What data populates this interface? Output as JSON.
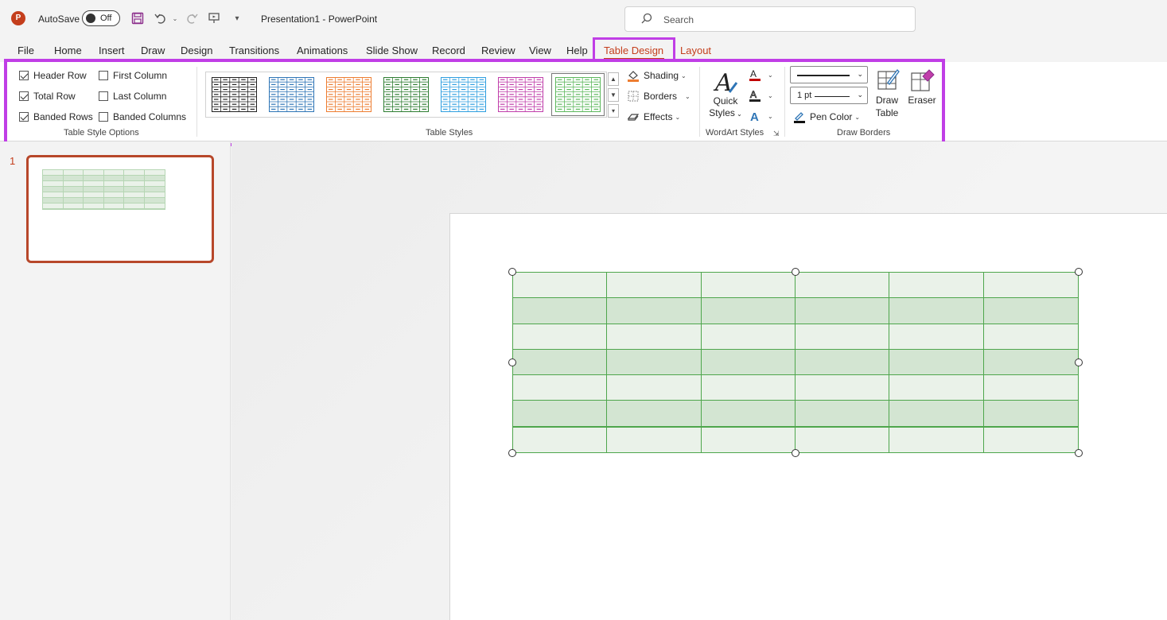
{
  "titlebar": {
    "app_icon_letter": "P",
    "autosave_label": "AutoSave",
    "autosave_state": "Off",
    "document_title": "Presentation1  -  PowerPoint",
    "search_placeholder": "Search",
    "icons": [
      "save-icon",
      "undo-icon",
      "redo-icon",
      "present-icon",
      "customize-qat-icon"
    ]
  },
  "tabs": [
    {
      "label": "File"
    },
    {
      "label": "Home"
    },
    {
      "label": "Insert"
    },
    {
      "label": "Draw"
    },
    {
      "label": "Design"
    },
    {
      "label": "Transitions"
    },
    {
      "label": "Animations"
    },
    {
      "label": "Slide Show"
    },
    {
      "label": "Record"
    },
    {
      "label": "Review"
    },
    {
      "label": "View"
    },
    {
      "label": "Help"
    },
    {
      "label": "Table Design",
      "active": true
    },
    {
      "label": "Layout"
    }
  ],
  "ribbon": {
    "style_options": {
      "label": "Table Style Options",
      "header_row": {
        "label": "Header Row",
        "checked": true
      },
      "total_row": {
        "label": "Total Row",
        "checked": true
      },
      "banded_rows": {
        "label": "Banded Rows",
        "checked": true
      },
      "first_column": {
        "label": "First Column",
        "checked": false
      },
      "last_column": {
        "label": "Last Column",
        "checked": false
      },
      "banded_columns": {
        "label": "Banded Columns",
        "checked": false
      }
    },
    "table_styles": {
      "label": "Table Styles",
      "gallery_colors": [
        "#222222",
        "#2e75b6",
        "#ed7d31",
        "#2e7d32",
        "#2f9fe0",
        "#c03eaa",
        "#5cb85c"
      ],
      "selected_index": 6,
      "shading": "Shading",
      "borders": "Borders",
      "effects": "Effects"
    },
    "wordart": {
      "label": "WordArt Styles",
      "quick_styles": "Quick Styles",
      "text_fill_color": "#c00000",
      "text_outline_color": "#222222",
      "text_effects_color": "#2e75b6"
    },
    "draw_borders": {
      "label": "Draw Borders",
      "pen_weight": "1 pt",
      "pen_color": "Pen Color",
      "draw_table": "Draw Table",
      "eraser": "Eraser"
    }
  },
  "slides": [
    {
      "number": "1"
    }
  ],
  "table": {
    "rows": 7,
    "columns": 6,
    "band_color": "#d3e5d2",
    "light_color": "#eaf2e9",
    "border_color": "#4ea64c"
  },
  "highlight_color": "#c03ee6"
}
